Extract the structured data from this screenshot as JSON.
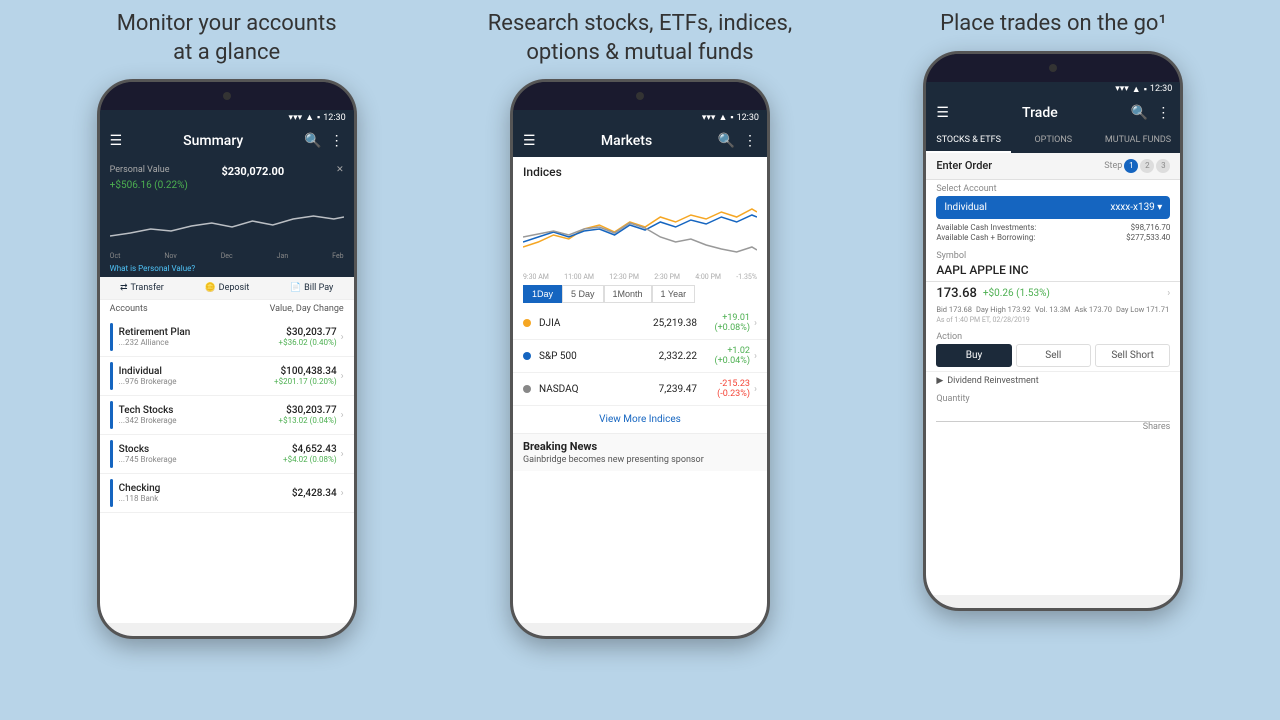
{
  "panels": [
    {
      "id": "summary",
      "title": "Monitor your accounts\nat a glance",
      "header": {
        "menu_icon": "☰",
        "title": "Summary",
        "search_icon": "🔍",
        "more_icon": "⋮"
      },
      "status_time": "12:30",
      "personal_value": {
        "label": "Personal Value",
        "value": "$230,072.00",
        "change": "+$506.16 (0.22%)",
        "chart_labels": [
          "Oct",
          "Nov",
          "Dec",
          "Jan",
          "Feb"
        ]
      },
      "pv_link": "What is Personal Value?",
      "actions": [
        "Transfer",
        "Deposit",
        "Bill Pay"
      ],
      "accounts_header": [
        "Accounts",
        "Value, Day Change"
      ],
      "accounts": [
        {
          "name": "Retirement Plan",
          "sub": "...232 Alliance",
          "value": "$30,203.77",
          "change": "+$36.02 (0.40%)"
        },
        {
          "name": "Individual",
          "sub": "...976 Brokerage",
          "value": "$100,438.34",
          "change": "+$201.17 (0.20%)"
        },
        {
          "name": "Tech Stocks",
          "sub": "...342 Brokerage",
          "value": "$30,203.77",
          "change": "+$13.02 (0.04%)"
        },
        {
          "name": "Stocks",
          "sub": "...745 Brokerage",
          "value": "$4,652.43",
          "change": "+$4.02 (0.08%)"
        },
        {
          "name": "Checking",
          "sub": "...118 Bank",
          "value": "$2,428.34",
          "change": ""
        }
      ]
    },
    {
      "id": "markets",
      "title": "Research stocks, ETFs, indices,\noptions & mutual funds",
      "header": {
        "menu_icon": "☰",
        "title": "Markets",
        "search_icon": "🔍",
        "more_icon": "⋮"
      },
      "status_time": "12:30",
      "indices_title": "Indices",
      "timeframes": [
        "1 Day",
        "5 Day",
        "1 Month",
        "1 Year"
      ],
      "active_timeframe": 0,
      "indices": [
        {
          "name": "DJIA",
          "value": "25,219.38",
          "change": "+19.01",
          "change_pct": "(+0.08%)",
          "positive": true,
          "color": "#f5a623"
        },
        {
          "name": "S&P 500",
          "value": "2,332.22",
          "change": "+1.02",
          "change_pct": "(+0.04%)",
          "positive": true,
          "color": "#1565c0"
        },
        {
          "name": "NASDAQ",
          "value": "7,239.47",
          "change": "-215.23",
          "change_pct": "(-0.23%)",
          "positive": false,
          "color": "#888"
        }
      ],
      "view_more": "View More Indices",
      "breaking_news": {
        "title": "Breaking News",
        "text": "Gainbridge becomes new presenting sponsor"
      }
    },
    {
      "id": "trade",
      "title": "Place trades on the go¹",
      "header": {
        "menu_icon": "☰",
        "title": "Trade",
        "search_icon": "🔍",
        "more_icon": "⋮"
      },
      "status_time": "12:30",
      "tabs": [
        "STOCKS & ETFS",
        "OPTIONS",
        "MUTUAL FUNDS"
      ],
      "active_tab": 0,
      "enter_order": {
        "label": "Enter Order",
        "step_label": "Step",
        "steps": [
          "1",
          "2",
          "3"
        ],
        "active_step": 0
      },
      "select_account": {
        "label": "Select Account",
        "value": "Individual",
        "account_num": "xxxx-x139"
      },
      "cash": {
        "available_cash": {
          "label": "Available Cash Investments:",
          "value": "$98,716.70"
        },
        "available_borrowing": {
          "label": "Available Cash + Borrowing:",
          "value": "$277,533.40"
        }
      },
      "symbol": {
        "label": "Symbol",
        "value": "AAPL APPLE INC"
      },
      "price": {
        "main": "173.68",
        "change": "+$0.26 (1.53%)",
        "bid": "173.68",
        "ask": "173.70",
        "day_high": "173.92",
        "day_low": "171.71",
        "volume": "13.3M",
        "timestamp": "As of 1:40 PM ET, 02/28/2019"
      },
      "action": {
        "label": "Action",
        "buttons": [
          "Buy",
          "Sell",
          "Sell Short"
        ],
        "active": 0
      },
      "dividend": "Dividend Reinvestment",
      "quantity": {
        "label": "Quantity",
        "shares_label": "Shares"
      }
    }
  ],
  "bottom_icons": [
    "↵",
    "□",
    "←"
  ]
}
